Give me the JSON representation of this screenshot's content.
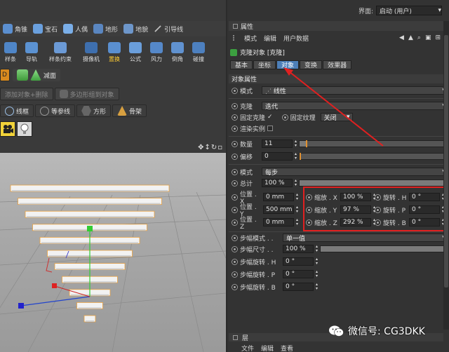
{
  "topbar": {
    "layout_label": "界面:",
    "layout_value": "启动 (用户)"
  },
  "toolbar": {
    "row1": [
      "角锥",
      "宝石",
      "人偶",
      "地形",
      "地貌",
      "引导线"
    ],
    "row2": [
      "样条",
      "导轨",
      "样条约束",
      "摄像机",
      "置换",
      "公式",
      "风力",
      "倒角",
      "碰撞"
    ],
    "row2_active": "置换",
    "row3_prefix": "D",
    "row3_label": "减面",
    "row4": [
      "添加对象+删除",
      "多边形组到对象"
    ],
    "row5": [
      "线框",
      "等参线",
      "方形",
      "骨架"
    ]
  },
  "attributes": {
    "panel_title": "属性",
    "menu": [
      "模式",
      "编辑",
      "用户数据"
    ],
    "object_title": "克隆对象 [克隆]",
    "tabs": [
      "基本",
      "坐标",
      "对象",
      "变换",
      "效果器"
    ],
    "active_tab": "对象",
    "section1": "对象属性",
    "mode_label": "模式",
    "mode_value": "线性",
    "clone_label": "克隆",
    "clone_value": "迭代",
    "fix_clone_label": "固定克隆",
    "fix_clone_check": "✓",
    "fix_texture_label": "固定纹理",
    "fix_texture_value": "关闭",
    "render_instance_label": "渲染实例",
    "count_label": "数量",
    "count_value": "11",
    "count_level": 0.05,
    "offset_label": "偏移",
    "offset_value": "0",
    "mode2_label": "模式",
    "mode2_value": "每步",
    "total_label": "总计",
    "total_value": "100 %",
    "total_level": 1.0,
    "position": [
      {
        "label": "位置 . X",
        "value": "0 mm"
      },
      {
        "label": "位置 . Y",
        "value": "500 mm"
      },
      {
        "label": "位置 . Z",
        "value": "0 mm"
      }
    ],
    "scale": [
      {
        "label": "缩放 . X",
        "value": "100 %"
      },
      {
        "label": "缩放 . Y",
        "value": "97 %"
      },
      {
        "label": "缩放 . Z",
        "value": "292 %"
      }
    ],
    "rotation": [
      {
        "label": "旋转 . H",
        "value": "0 °"
      },
      {
        "label": "旋转 . P",
        "value": "0 °"
      },
      {
        "label": "旋转 . B",
        "value": "0 °"
      }
    ],
    "step_mode_label": "步幅模式 . .",
    "step_mode_value": "单一值",
    "step_size_label": "步幅尺寸 . .",
    "step_size_value": "100 %",
    "step_size_level": 1.0,
    "step_rot": [
      {
        "label": "步幅旋转 . H",
        "value": "0 °"
      },
      {
        "label": "步幅旋转 . P",
        "value": "0 °"
      },
      {
        "label": "步幅旋转 . B",
        "value": "0 °"
      }
    ]
  },
  "layers": {
    "title": "层",
    "menu": [
      "文件",
      "编辑",
      "查看"
    ]
  },
  "watermark": "微信号: CG3DKK",
  "colors": {
    "accent_tab": "#4d7fb8",
    "highlight_box": "#e02020",
    "slider_mark": "#e09030",
    "clone_box": "#f2f2f2",
    "clone_edge": "#e8a040"
  }
}
